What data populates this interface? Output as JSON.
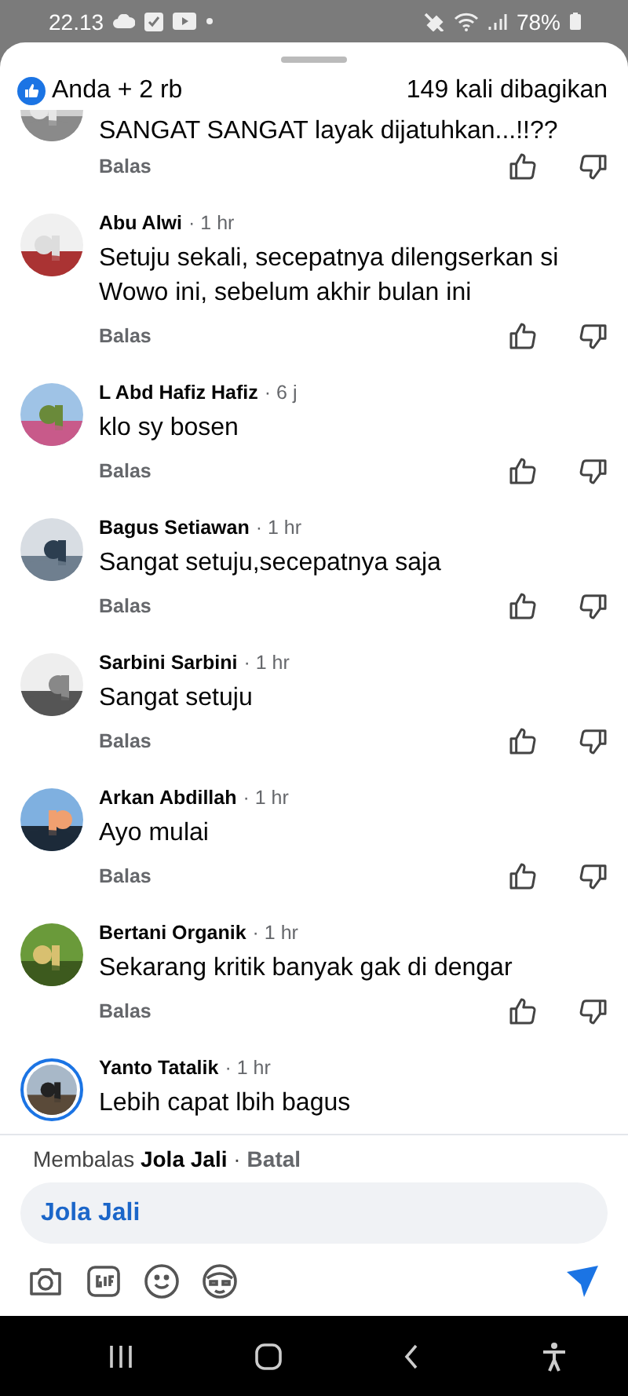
{
  "status_bar": {
    "time": "22.13",
    "battery": "78%"
  },
  "header": {
    "reactions": "Anda + 2 rb",
    "shares": "149 kali dibagikan"
  },
  "comments": [
    {
      "text": "SANGAT SANGAT layak dijatuhkan...!!??",
      "reply": "Balas",
      "story_ring": false
    },
    {
      "name": "Abu Alwi",
      "time": "· 1 hr",
      "text": "Setuju sekali, secepatnya dilengserkan si Wowo ini, sebelum akhir bulan ini",
      "reply": "Balas",
      "story_ring": false
    },
    {
      "name": "L Abd Hafiz Hafiz",
      "time": "· 6 j",
      "text": "klo sy bosen",
      "reply": "Balas",
      "story_ring": false
    },
    {
      "name": "Bagus Setiawan",
      "time": "· 1 hr",
      "text": "Sangat setuju,secepatnya saja",
      "reply": "Balas",
      "story_ring": false
    },
    {
      "name": "Sarbini Sarbini",
      "time": "· 1 hr",
      "text": "Sangat setuju",
      "reply": "Balas",
      "story_ring": false
    },
    {
      "name": "Arkan Abdillah",
      "time": "· 1 hr",
      "text": "Ayo mulai",
      "reply": "Balas",
      "story_ring": false
    },
    {
      "name": "Bertani Organik",
      "time": "· 1 hr",
      "text": "Sekarang kritik banyak gak di dengar",
      "reply": "Balas",
      "story_ring": false
    },
    {
      "name": "Yanto Tatalik",
      "time": "· 1 hr",
      "text": "Lebih capat lbih bagus",
      "story_ring": true
    }
  ],
  "composer": {
    "replying": "Membalas **Jola Jali** ·",
    "cancel": "Batal",
    "value": "Jola Jali"
  }
}
